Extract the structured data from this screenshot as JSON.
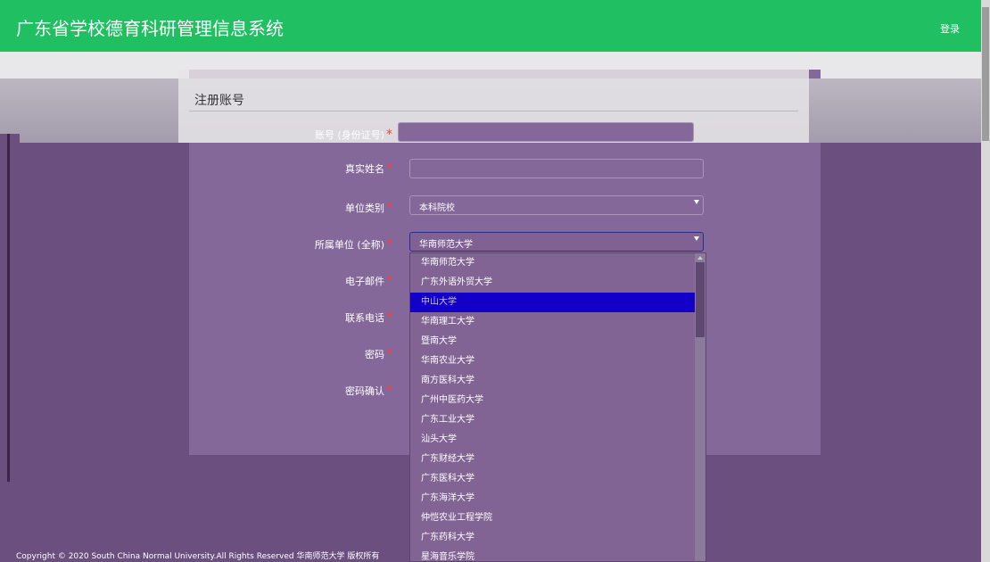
{
  "header": {
    "title": "广东省学校德育科研管理信息系统",
    "login": "登录"
  },
  "form": {
    "title": "注册账号",
    "fields": [
      {
        "label": "账号 (身份证号)",
        "value": ""
      },
      {
        "label": "真实姓名",
        "value": ""
      },
      {
        "label": "单位类别",
        "value": "本科院校"
      },
      {
        "label": "所属单位 (全称)",
        "value": "华南师范大学"
      },
      {
        "label": "电子邮件",
        "value": ""
      },
      {
        "label": "联系电话",
        "value": ""
      },
      {
        "label": "密码",
        "value": ""
      },
      {
        "label": "密码确认",
        "value": ""
      }
    ],
    "required_mark": "*"
  },
  "dropdown": {
    "options": [
      "华南师范大学",
      "广东外语外贸大学",
      "中山大学",
      "华南理工大学",
      "暨南大学",
      "华南农业大学",
      "南方医科大学",
      "广州中医药大学",
      "广东工业大学",
      "汕头大学",
      "广东财经大学",
      "广东医科大学",
      "广东海洋大学",
      "仲恺农业工程学院",
      "广东药科大学",
      "星海音乐学院"
    ],
    "highlighted_index": 2
  },
  "footer": {
    "copyright": "Copyright © 2020 South China Normal University.All Rights Reserved 华南师范大学 版权所有"
  },
  "colors": {
    "header_bg": "#1fbf62",
    "required": "#ff3b3b",
    "highlight": "#1300c8"
  }
}
